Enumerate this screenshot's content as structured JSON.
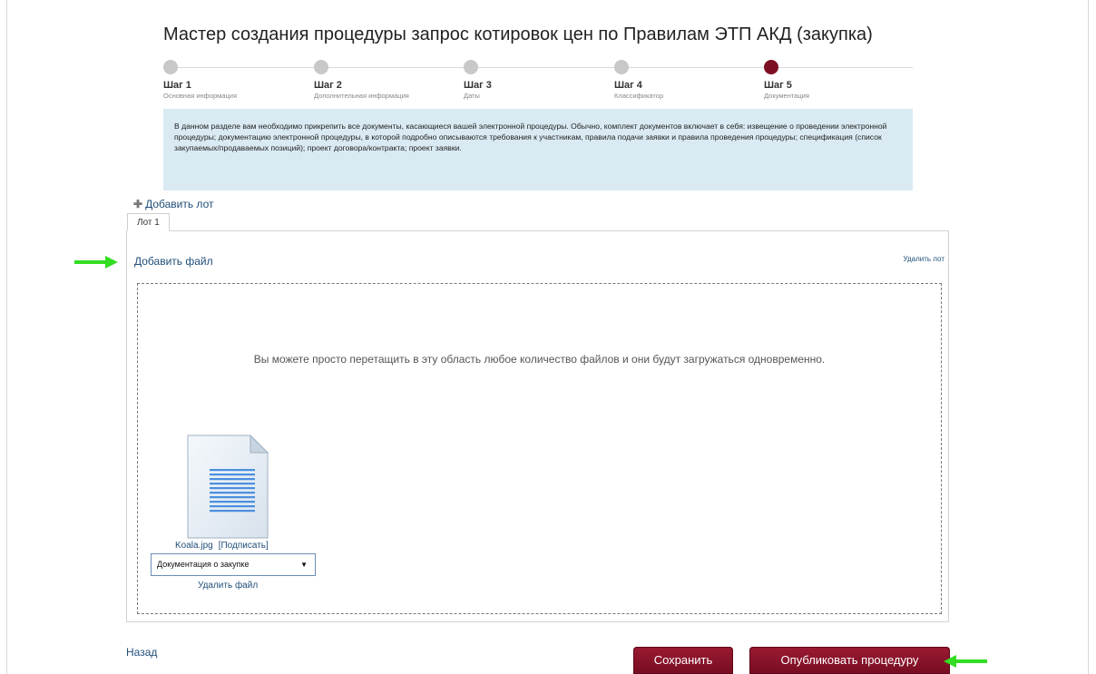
{
  "title": "Мастер создания процедуры запрос котировок цен по Правилам ЭТП АКД (закупка)",
  "steps": [
    {
      "title": "Шаг 1",
      "subtitle": "Основная информация",
      "active": false
    },
    {
      "title": "Шаг 2",
      "subtitle": "Дополнительная информация",
      "active": false
    },
    {
      "title": "Шаг 3",
      "subtitle": "Даты",
      "active": false
    },
    {
      "title": "Шаг 4",
      "subtitle": "Классификатор",
      "active": false
    },
    {
      "title": "Шаг 5",
      "subtitle": "Документация",
      "active": true
    }
  ],
  "info_text": "В данном разделе вам необходимо прикрепить все документы, касающиеся вашей электронной процедуры. Обычно, комплект документов включает в себя: извещение о проведении электронной процедуры; документацию электронной процедуры, в которой подробно описываются требования к участникам, правила подачи заявки и правила проведения процедуры; спецификация (список закупаемых/продаваемых позиций); проект договора/контракта; проект заявки.",
  "add_lot": "Добавить лот",
  "lot_tab": "Лот 1",
  "add_file": "Добавить файл",
  "delete_lot": "Удалить лот",
  "drop_hint": "Вы можете просто перетащить в эту область любое количество файлов и они будут загружаться одновременно.",
  "file": {
    "name": "Koala.jpg",
    "sign_link": "[Подписать]",
    "doc_type": "Документация о закупке",
    "delete": "Удалить файл"
  },
  "back": "Назад",
  "save": "Сохранить",
  "publish": "Опубликовать процедуру",
  "colors": {
    "accent": "#7d0f25",
    "info_bg": "#d9eaf3",
    "link": "#1f4e79",
    "annotation_arrow": "#33dd22"
  },
  "icons": {
    "add_lot": "plus-icon",
    "file": "document-icon",
    "dropdown": "chevron-down-icon",
    "annotations": "arrow-icon"
  }
}
